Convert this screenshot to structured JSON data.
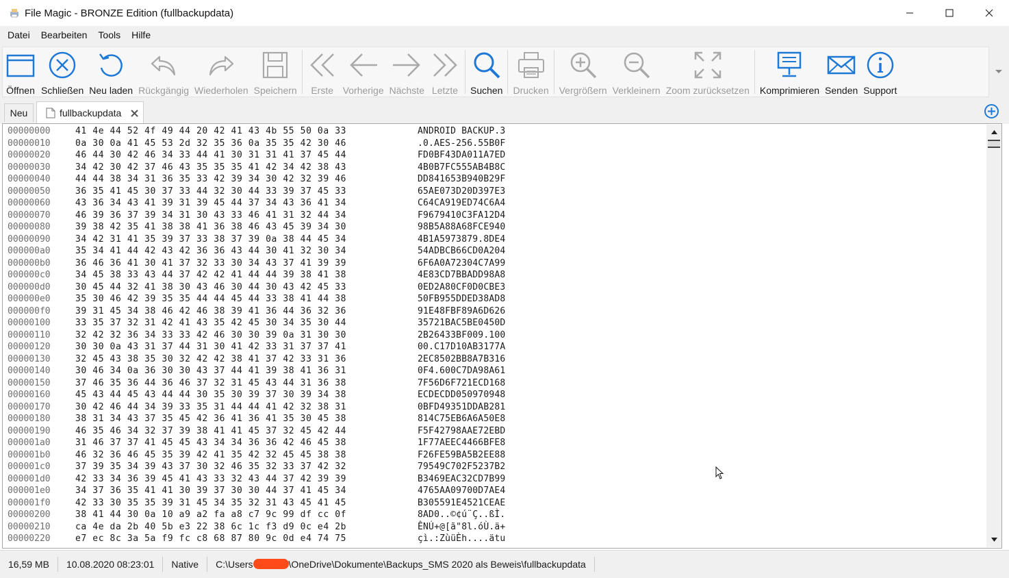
{
  "window": {
    "title": "File Magic - BRONZE Edition (fullbackupdata)"
  },
  "menu": [
    "Datei",
    "Bearbeiten",
    "Tools",
    "Hilfe"
  ],
  "toolbar": {
    "open": "Öffnen",
    "close": "Schließen",
    "reload": "Neu laden",
    "undo": "Rückgängig",
    "redo": "Wiederholen",
    "save": "Speichern",
    "first": "Erste",
    "previous": "Vorherige",
    "next": "Nächste",
    "last": "Letzte",
    "search": "Suchen",
    "print": "Drucken",
    "zoom_in": "Vergrößern",
    "zoom_out": "Verkleinern",
    "zoom_reset": "Zoom zurücksetzen",
    "compress": "Komprimieren",
    "send": "Senden",
    "support": "Support"
  },
  "tabs": {
    "new_label": "Neu",
    "file_label": "fullbackupdata"
  },
  "hex": [
    {
      "off": "00000000",
      "bytes": "41 4e 44 52 4f 49 44 20 42 41 43 4b 55 50 0a 33",
      "ascii": "ANDROID BACKUP.3"
    },
    {
      "off": "00000010",
      "bytes": "0a 30 0a 41 45 53 2d 32 35 36 0a 35 35 42 30 46",
      "ascii": ".0.AES-256.55B0F"
    },
    {
      "off": "00000020",
      "bytes": "46 44 30 42 46 34 33 44 41 30 31 31 41 37 45 44",
      "ascii": "FD0BF43DA011A7ED"
    },
    {
      "off": "00000030",
      "bytes": "34 42 30 42 37 46 43 35 35 35 41 42 34 42 38 43",
      "ascii": "4B0B7FC555AB4B8C"
    },
    {
      "off": "00000040",
      "bytes": "44 44 38 34 31 36 35 33 42 39 34 30 42 32 39 46",
      "ascii": "DD841653B940B29F"
    },
    {
      "off": "00000050",
      "bytes": "36 35 41 45 30 37 33 44 32 30 44 33 39 37 45 33",
      "ascii": "65AE073D20D397E3"
    },
    {
      "off": "00000060",
      "bytes": "43 36 34 43 41 39 31 39 45 44 37 34 43 36 41 34",
      "ascii": "C64CA919ED74C6A4"
    },
    {
      "off": "00000070",
      "bytes": "46 39 36 37 39 34 31 30 43 33 46 41 31 32 44 34",
      "ascii": "F9679410C3FA12D4"
    },
    {
      "off": "00000080",
      "bytes": "39 38 42 35 41 38 38 41 36 38 46 43 45 39 34 30",
      "ascii": "98B5A88A68FCE940"
    },
    {
      "off": "00000090",
      "bytes": "34 42 31 41 35 39 37 33 38 37 39 0a 38 44 45 34",
      "ascii": "4B1A5973879.8DE4"
    },
    {
      "off": "000000a0",
      "bytes": "35 34 41 44 42 43 42 36 36 43 44 30 41 32 30 34",
      "ascii": "54ADBCB66CD0A204"
    },
    {
      "off": "000000b0",
      "bytes": "36 46 36 41 30 41 37 32 33 30 34 43 37 41 39 39",
      "ascii": "6F6A0A72304C7A99"
    },
    {
      "off": "000000c0",
      "bytes": "34 45 38 33 43 44 37 42 42 41 44 44 39 38 41 38",
      "ascii": "4E83CD7BBADD98A8"
    },
    {
      "off": "000000d0",
      "bytes": "30 45 44 32 41 38 30 43 46 30 44 30 43 42 45 33",
      "ascii": "0ED2A80CF0D0CBE3"
    },
    {
      "off": "000000e0",
      "bytes": "35 30 46 42 39 35 35 44 44 45 44 33 38 41 44 38",
      "ascii": "50FB955DDED38AD8"
    },
    {
      "off": "000000f0",
      "bytes": "39 31 45 34 38 46 42 46 38 39 41 36 44 36 32 36",
      "ascii": "91E48FBF89A6D626"
    },
    {
      "off": "00000100",
      "bytes": "33 35 37 32 31 42 41 43 35 42 45 30 34 35 30 44",
      "ascii": "35721BAC5BE0450D"
    },
    {
      "off": "00000110",
      "bytes": "32 42 32 36 34 33 33 42 46 30 30 39 0a 31 30 30",
      "ascii": "2B26433BF009.100"
    },
    {
      "off": "00000120",
      "bytes": "30 30 0a 43 31 37 44 31 30 41 42 33 31 37 37 41",
      "ascii": "00.C17D10AB3177A"
    },
    {
      "off": "00000130",
      "bytes": "32 45 43 38 35 30 32 42 42 38 41 37 42 33 31 36",
      "ascii": "2EC8502BB8A7B316"
    },
    {
      "off": "00000140",
      "bytes": "30 46 34 0a 36 30 30 43 37 44 41 39 38 41 36 31",
      "ascii": "0F4.600C7DA98A61"
    },
    {
      "off": "00000150",
      "bytes": "37 46 35 36 44 36 46 37 32 31 45 43 44 31 36 38",
      "ascii": "7F56D6F721ECD168"
    },
    {
      "off": "00000160",
      "bytes": "45 43 44 45 43 44 44 30 35 30 39 37 30 39 34 38",
      "ascii": "ECDECDD050970948"
    },
    {
      "off": "00000170",
      "bytes": "30 42 46 44 34 39 33 35 31 44 44 41 42 32 38 31",
      "ascii": "0BFD49351DDAB281"
    },
    {
      "off": "00000180",
      "bytes": "38 31 34 43 37 35 45 42 36 41 36 41 35 30 45 38",
      "ascii": "814C75EB6A6A50E8"
    },
    {
      "off": "00000190",
      "bytes": "46 35 46 34 32 37 39 38 41 41 45 37 32 45 42 44",
      "ascii": "F5F42798AAE72EBD"
    },
    {
      "off": "000001a0",
      "bytes": "31 46 37 37 41 45 45 43 34 34 36 36 42 46 45 38",
      "ascii": "1F77AEEC4466BFE8"
    },
    {
      "off": "000001b0",
      "bytes": "46 32 36 46 45 35 39 42 41 35 42 32 45 45 38 38",
      "ascii": "F26FE59BA5B2EE88"
    },
    {
      "off": "000001c0",
      "bytes": "37 39 35 34 39 43 37 30 32 46 35 32 33 37 42 32",
      "ascii": "79549C702F5237B2"
    },
    {
      "off": "000001d0",
      "bytes": "42 33 34 36 39 45 41 43 33 32 43 44 37 42 39 39",
      "ascii": "B3469EAC32CD7B99"
    },
    {
      "off": "000001e0",
      "bytes": "34 37 36 35 41 41 30 39 37 30 30 44 37 41 45 34",
      "ascii": "4765AA09700D7AE4"
    },
    {
      "off": "000001f0",
      "bytes": "42 33 30 35 35 39 31 45 34 35 32 31 43 45 41 45",
      "ascii": "B305591E4521CEAE"
    },
    {
      "off": "00000200",
      "bytes": "38 41 44 30 0a 10 a9 a2 fa a8 c7 9c 99 df cc 0f",
      "ascii": "8AD0..©¢ú¨Ç..ßÌ."
    },
    {
      "off": "00000210",
      "bytes": "ca 4e da 2b 40 5b e3 22 38 6c 1c f3 d9 0c e4 2b",
      "ascii": "ÊNÚ+@[ã\"8l.óÙ.ä+"
    },
    {
      "off": "00000220",
      "bytes": "e7 ec 8c 3a 5a f9 fc c8 68 87 80 9c 0d e4 74 75",
      "ascii": "çì.:ZùüÈh....ätu"
    }
  ],
  "status": {
    "size": "16,59 MB",
    "date": "10.08.2020 08:23:01",
    "mode": "Native",
    "path_prefix": "C:\\Users",
    "path_suffix": "\\OneDrive\\Dokumente\\Backups_SMS 2020 als Beweis\\fullbackupdata"
  },
  "colors": {
    "accent_blue": "#1e78d6",
    "disabled_gray": "#a9a9a9",
    "redaction": "#ff4a1a"
  }
}
